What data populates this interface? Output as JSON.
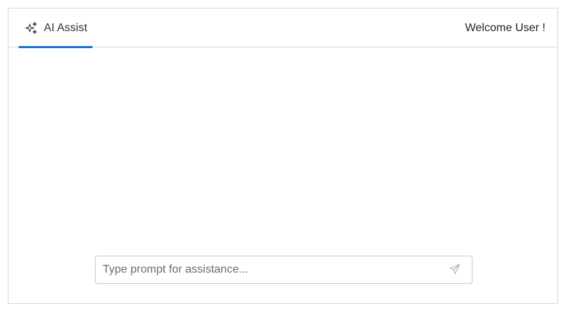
{
  "header": {
    "tab": {
      "label": "AI Assist",
      "icon": "sparkles-icon",
      "active": true
    },
    "welcome_text": "Welcome User !"
  },
  "prompt": {
    "value": "",
    "placeholder": "Type prompt for assistance...",
    "send_icon": "send-icon"
  },
  "colors": {
    "accent": "#1a73d9",
    "border": "#d9d9d9",
    "text": "#333333"
  }
}
